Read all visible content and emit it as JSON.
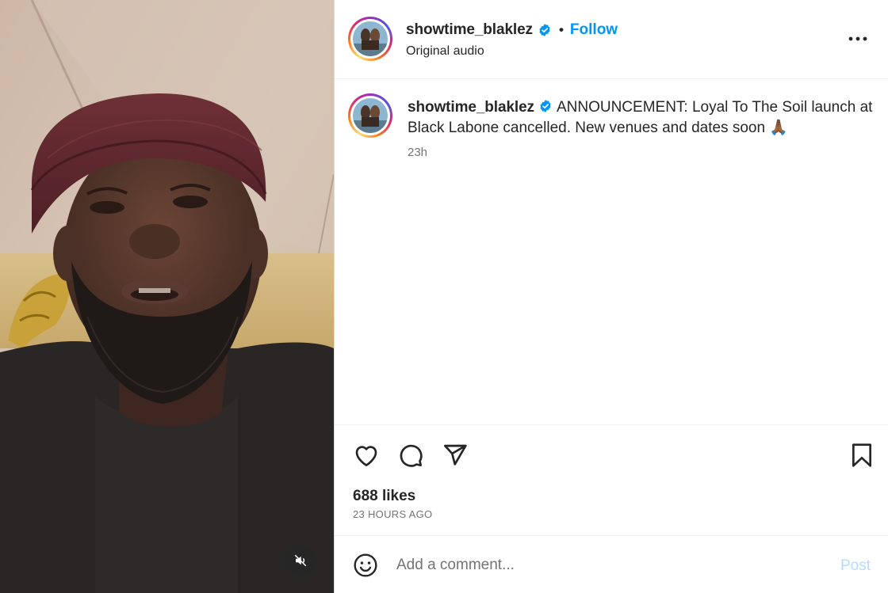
{
  "post": {
    "author": {
      "username": "showtime_blaklez",
      "verified": true,
      "verified_color": "#0095f6",
      "avatar_ring_colors": [
        "#feda75",
        "#fa7e1e",
        "#d62976",
        "#962fbf",
        "#4f5bd5"
      ]
    },
    "header": {
      "separator": "•",
      "follow_label": "Follow",
      "follow_color": "#0095f6",
      "audio_label": "Original audio",
      "more_icon": "more-horizontal-icon"
    },
    "caption": {
      "text": "ANNOUNCEMENT: Loyal To The Soil launch at Black Labone cancelled. New venues and dates soon",
      "emoji": "🙏🏾",
      "time_ago": "23h"
    },
    "actions": {
      "like_icon": "heart-icon",
      "comment_icon": "comment-icon",
      "share_icon": "send-icon",
      "save_icon": "bookmark-icon",
      "likes_label": "688 likes",
      "posted_ago": "23 HOURS AGO"
    },
    "comment_box": {
      "emoji_icon": "smiley-icon",
      "placeholder": "Add a comment...",
      "post_label": "Post",
      "post_color": "#b3dbff"
    },
    "media": {
      "type": "video",
      "mute_icon": "muted-speaker-icon",
      "muted": true
    }
  }
}
